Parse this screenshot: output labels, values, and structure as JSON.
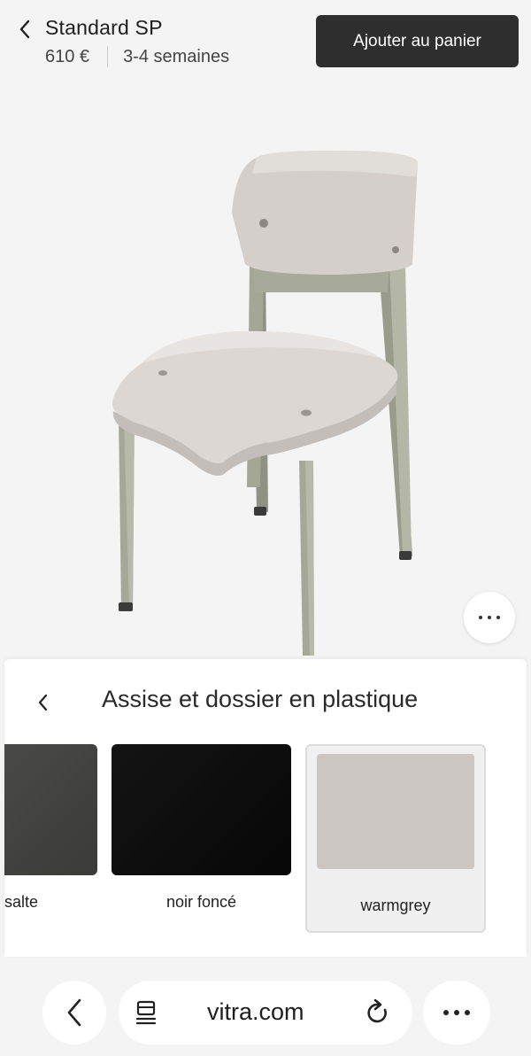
{
  "header": {
    "title": "Standard SP",
    "price": "610 €",
    "delivery": "3-4 semaines",
    "add_to_cart_label": "Ajouter au panier"
  },
  "product": {
    "image_alt_icon": "chair-image",
    "more_icon": "more-horizontal-icon"
  },
  "options_panel": {
    "title": "Assise et dossier en plastique",
    "swatches": [
      {
        "label": "salte",
        "color": "#454543"
      },
      {
        "label": "noir foncé",
        "color": "#0d0d0d"
      },
      {
        "label": "warmgrey",
        "color": "#ccc6c3",
        "selected": true
      }
    ]
  },
  "browser": {
    "url": "vitra.com"
  },
  "colors": {
    "background": "#f4f4f4",
    "button_dark": "#2e2e2e",
    "chair_shell": "#d8d3cf",
    "chair_frame": "#a9ab9b"
  }
}
